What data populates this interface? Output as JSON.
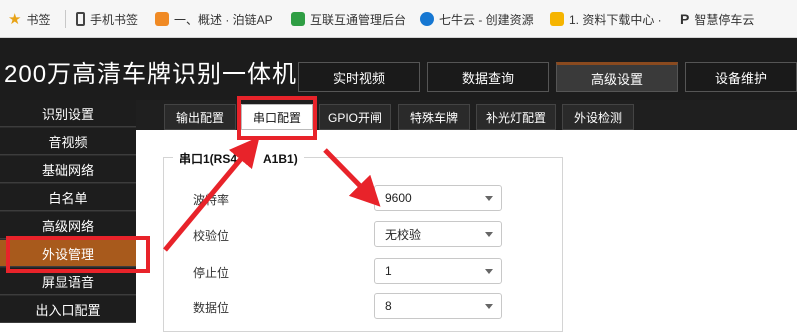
{
  "bookmarks": [
    {
      "label": "书签",
      "icon": "star-icon",
      "color": "#e8a317"
    },
    {
      "label": "手机书签",
      "icon": "phone-icon",
      "color": "#444444"
    },
    {
      "label": "一、概述 · 泊链AP",
      "icon": "orange-site-icon",
      "color": "#f08a24"
    },
    {
      "label": "互联互通管理后台",
      "icon": "green-site-icon",
      "color": "#2f9e44"
    },
    {
      "label": "七牛云 - 创建资源",
      "icon": "qiniu-icon",
      "color": "#1677d2"
    },
    {
      "label": "1. 资料下载中心 ·",
      "icon": "yellow-site-icon",
      "color": "#f5b400"
    },
    {
      "label": "智慧停车云",
      "icon": "parking-icon",
      "color": "#333333"
    }
  ],
  "app": {
    "title": "200万高清车牌识别一体机",
    "top_nav": [
      "实时视频",
      "数据查询",
      "高级设置",
      "设备维护"
    ],
    "top_nav_active": "高级设置"
  },
  "sidebar": {
    "items": [
      "识别设置",
      "音视频",
      "基础网络",
      "白名单",
      "高级网络",
      "外设管理",
      "屏显语音",
      "出入口配置"
    ],
    "active": "外设管理"
  },
  "tabs": {
    "items": [
      "输出配置",
      "串口配置",
      "GPIO开闸",
      "特殊车牌",
      "补光灯配置",
      "外设检测"
    ],
    "active": "串口配置"
  },
  "serial_panel": {
    "legend": "串口1(RS4",
    "legend_tail": "A1B1)",
    "fields": [
      {
        "label": "波特率",
        "value": "9600"
      },
      {
        "label": "校验位",
        "value": "无校验"
      },
      {
        "label": "停止位",
        "value": "1"
      },
      {
        "label": "数据位",
        "value": "8"
      }
    ]
  },
  "colors": {
    "accent_active": "#a85a1c",
    "annotation_red": "#e8232a",
    "header_bg": "#1c1c1c"
  }
}
